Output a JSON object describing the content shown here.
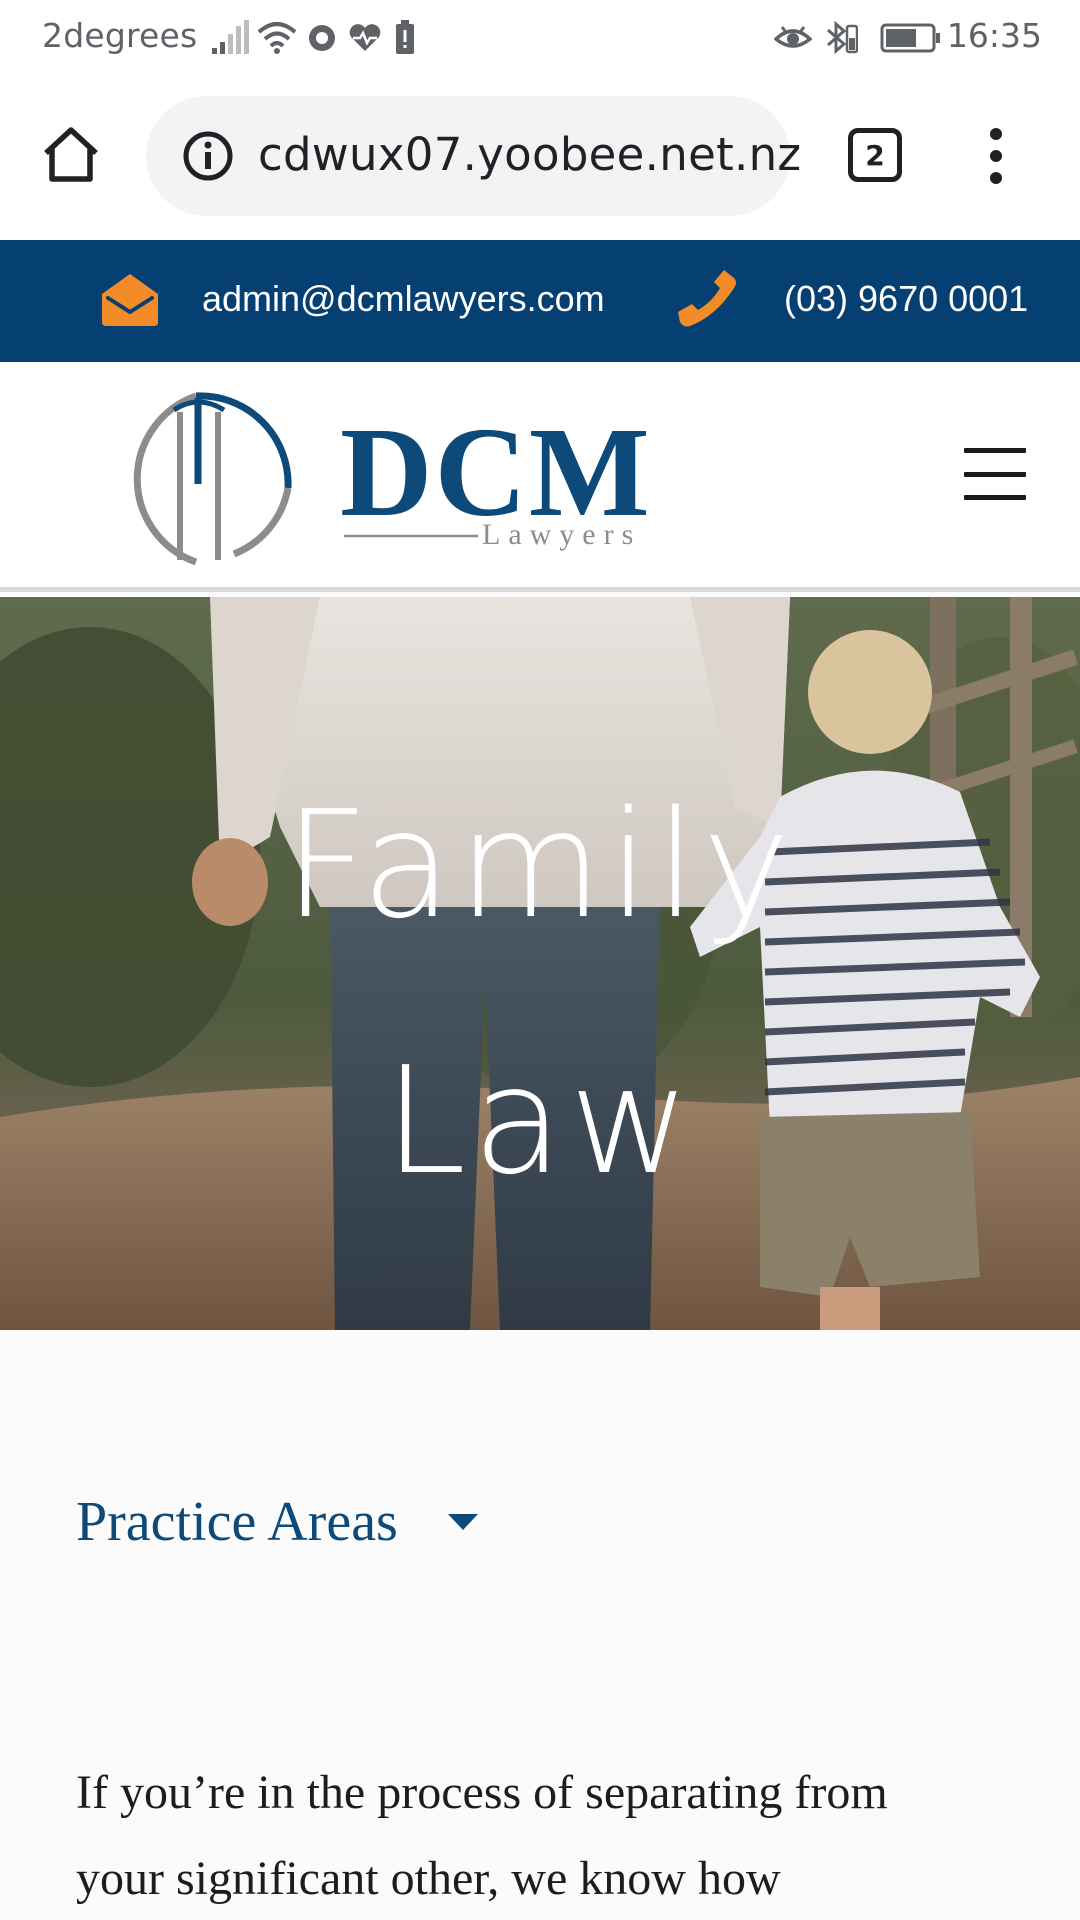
{
  "status_bar": {
    "carrier": "2degrees",
    "time": "16:35",
    "icons_left": [
      "signal-icon",
      "wifi-icon",
      "record-icon",
      "health-icon",
      "battery-alert-icon"
    ],
    "icons_right": [
      "eye-icon",
      "bluetooth-icon",
      "battery-icon"
    ]
  },
  "browser": {
    "url": "cdwux07.yoobee.net.nz",
    "tab_count": "2"
  },
  "contact": {
    "email": "admin@dcmlawyers.com",
    "phone": "(03) 9670 0001",
    "accent_color": "#f28c28",
    "bar_color": "#063f72"
  },
  "logo": {
    "name": "DCM",
    "subtitle": "Lawyers"
  },
  "hero": {
    "title_line1": "Family",
    "title_line2": "Law"
  },
  "content": {
    "practice_areas_label": "Practice Areas",
    "body_line1": "If you’re in the process of separating from",
    "body_line2": "your significant other, we know how"
  }
}
